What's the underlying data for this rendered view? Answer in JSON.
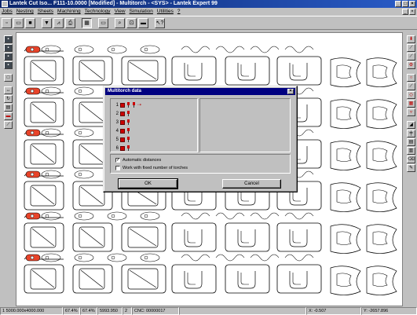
{
  "window": {
    "title": "Lantek Cut Iso... F111-10.0000 [Modified] - Multitorch - <SYS> - Lantek Expert 99"
  },
  "menu": {
    "items": [
      "Jobs",
      "Nesting",
      "Sheets",
      "Machining",
      "Technology",
      "View",
      "Simulation",
      "Utilities",
      "?"
    ]
  },
  "toolbar": {
    "icons": [
      "new-icon",
      "open-icon",
      "save-icon",
      "filter-icon",
      "chart-icon",
      "print-icon",
      "grid-icon",
      "window-icon",
      "zoom-icon",
      "zoom-window-icon",
      "sheet-icon",
      "help-icon"
    ]
  },
  "dialog": {
    "title": "Multitorch data",
    "torches": [
      "1",
      "2",
      "3",
      "4",
      "5",
      "6"
    ],
    "options": [
      {
        "label": "Automatic distances",
        "checked": true
      },
      {
        "label": "Work with fixed number of torches",
        "checked": false
      }
    ],
    "ok_label": "OK",
    "cancel_label": "Cancel"
  },
  "status": {
    "fields": [
      "1 5000.000x4000.000",
      "67.4%",
      "67.4%",
      "5993.950",
      "2",
      "CNC: 00000017",
      "",
      "X: -0.507",
      "Y: -2657.896"
    ]
  }
}
